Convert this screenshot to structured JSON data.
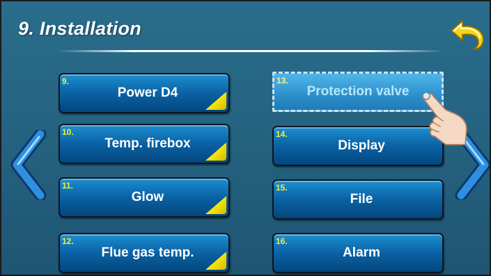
{
  "header": {
    "title": "9. Installation"
  },
  "menu": {
    "items": [
      {
        "num": "9.",
        "label": "Power D4"
      },
      {
        "num": "10.",
        "label": "Temp. firebox"
      },
      {
        "num": "11.",
        "label": "Glow"
      },
      {
        "num": "12.",
        "label": "Flue gas temp."
      },
      {
        "num": "13.",
        "label": "Protection valve",
        "selected": true
      },
      {
        "num": "14.",
        "label": "Display"
      },
      {
        "num": "15.",
        "label": "File"
      },
      {
        "num": "16.",
        "label": "Alarm"
      }
    ]
  },
  "icons": {
    "back": "back-arrow-icon",
    "prev": "chevron-left-icon",
    "next": "chevron-right-icon",
    "pointer": "hand-pointer-icon"
  },
  "colors": {
    "background": "#24617f",
    "button": "#0a63a6",
    "number": "#f3f03a",
    "corner": "#f4e20a",
    "selected": "#2f93cf"
  }
}
